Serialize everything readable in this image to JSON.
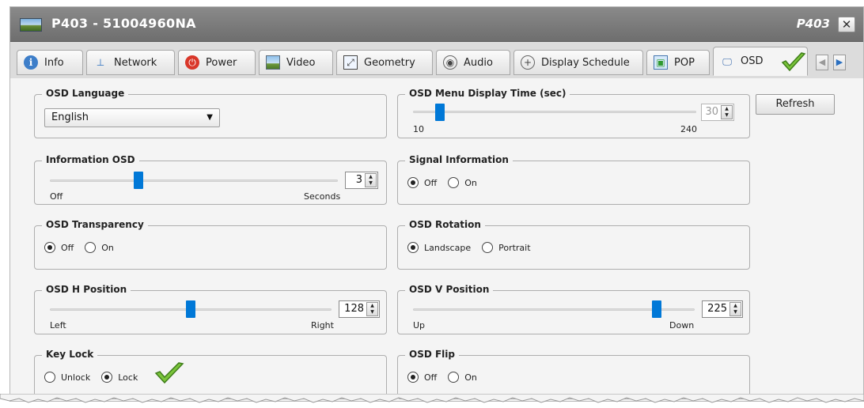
{
  "window": {
    "title": "P403 - 51004960NA",
    "model": "P403",
    "close_glyph": "✕"
  },
  "tabs": [
    {
      "label": "Info",
      "icon": "info-icon"
    },
    {
      "label": "Network",
      "icon": "network-icon"
    },
    {
      "label": "Power",
      "icon": "power-icon"
    },
    {
      "label": "Video",
      "icon": "video-icon"
    },
    {
      "label": "Geometry",
      "icon": "geometry-icon"
    },
    {
      "label": "Audio",
      "icon": "audio-icon"
    },
    {
      "label": "Display Schedule",
      "icon": "display-schedule-icon"
    },
    {
      "label": "POP",
      "icon": "pop-icon"
    },
    {
      "label": "OSD",
      "icon": "osd-icon",
      "active": true
    }
  ],
  "osd": {
    "language": {
      "title": "OSD Language",
      "value": "English"
    },
    "menu_display_time": {
      "title": "OSD Menu Display Time (sec)",
      "value": "30",
      "min_label": "10",
      "max_label": "240",
      "min": 10,
      "max": 240,
      "current": 30
    },
    "information_osd": {
      "title": "Information OSD",
      "value": "3",
      "min_label": "Off",
      "max_label": "Seconds",
      "fraction": 0.3
    },
    "signal_information": {
      "title": "Signal Information",
      "options": [
        "Off",
        "On"
      ],
      "selected": "Off"
    },
    "transparency": {
      "title": "OSD Transparency",
      "options": [
        "Off",
        "On"
      ],
      "selected": "Off"
    },
    "rotation": {
      "title": "OSD Rotation",
      "options": [
        "Landscape",
        "Portrait"
      ],
      "selected": "Landscape"
    },
    "h_position": {
      "title": "OSD H Position",
      "value": "128",
      "min_label": "Left",
      "max_label": "Right",
      "fraction": 0.5
    },
    "v_position": {
      "title": "OSD V Position",
      "value": "225",
      "min_label": "Up",
      "max_label": "Down",
      "fraction": 0.88
    },
    "key_lock": {
      "title": "Key Lock",
      "options": [
        "Unlock",
        "Lock"
      ],
      "selected": "Lock"
    },
    "flip": {
      "title": "OSD Flip",
      "options": [
        "Off",
        "On"
      ],
      "selected": "Off"
    }
  },
  "refresh_label": "Refresh",
  "colors": {
    "accent": "#0078d7",
    "check": "#7ac43a",
    "titlebar": "#7a7a7a"
  }
}
